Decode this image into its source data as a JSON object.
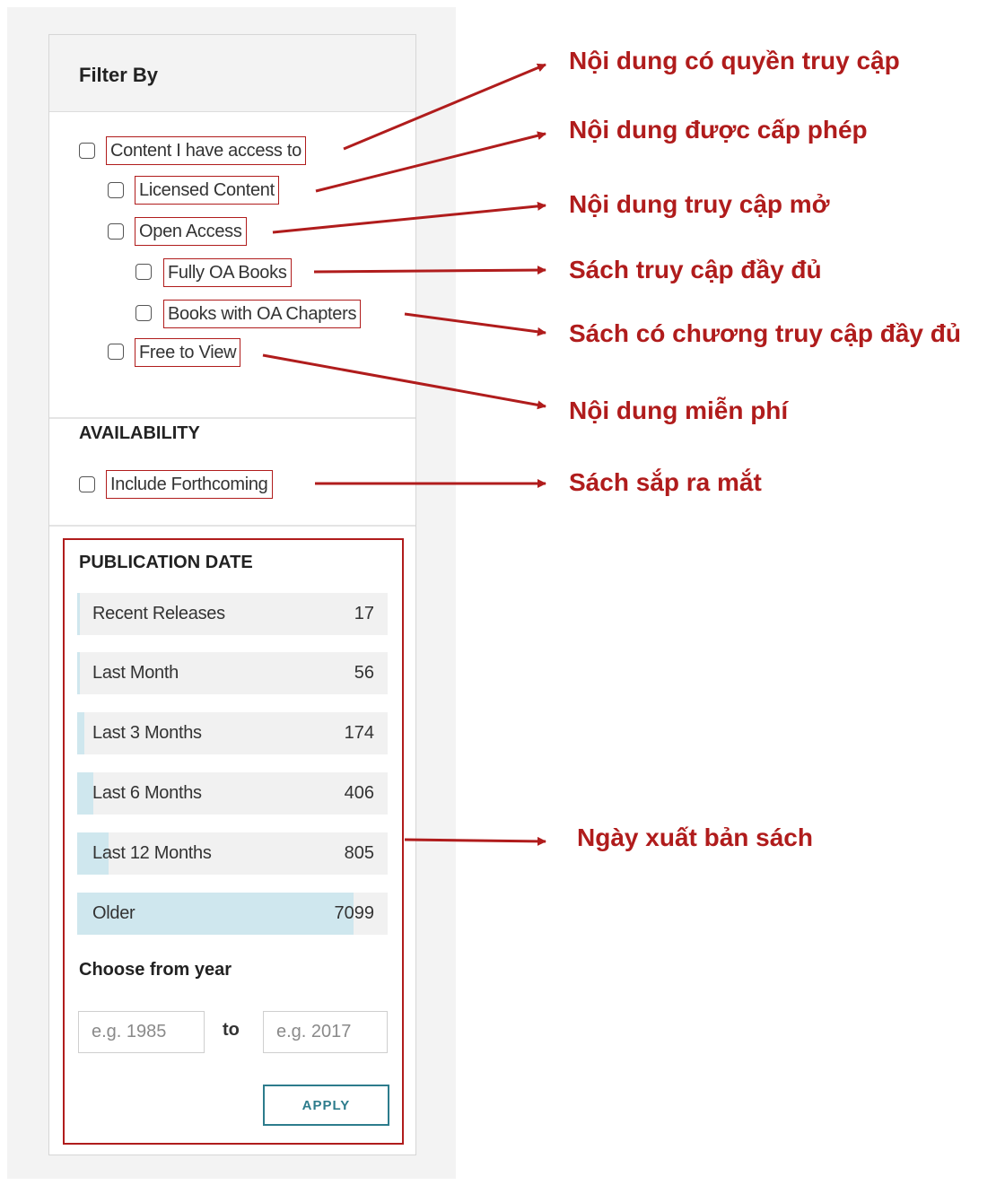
{
  "filter": {
    "title": "Filter By",
    "access_items": [
      {
        "label": "Content I have access to"
      },
      {
        "label": "Licensed Content"
      },
      {
        "label": "Open Access"
      },
      {
        "label": "Fully OA Books"
      },
      {
        "label": "Books with OA Chapters"
      },
      {
        "label": "Free to View"
      }
    ],
    "availability": {
      "title": "AVAILABILITY",
      "items": [
        {
          "label": "Include Forthcoming"
        }
      ]
    },
    "publication_date": {
      "title": "PUBLICATION DATE",
      "max_count": 7099,
      "rows": [
        {
          "label": "Recent Releases",
          "count": "17",
          "value": 17
        },
        {
          "label": "Last Month",
          "count": "56",
          "value": 56
        },
        {
          "label": "Last 3 Months",
          "count": "174",
          "value": 174
        },
        {
          "label": "Last 6 Months",
          "count": "406",
          "value": 406
        },
        {
          "label": "Last 12 Months",
          "count": "805",
          "value": 805
        },
        {
          "label": "Older",
          "count": "7099",
          "value": 7099
        }
      ],
      "year_title": "Choose from year",
      "from_placeholder": "e.g. 1985",
      "to_label": "to",
      "to_placeholder": "e.g. 2017",
      "apply_label": "APPLY"
    }
  },
  "annotations": [
    "Nội dung có quyền truy cập",
    "Nội dung được cấp phép",
    "Nội dung truy cập mở",
    "Sách truy cập đầy đủ",
    "Sách có chương truy cập đầy đủ",
    "Nội dung miễn phí",
    "Sách sắp ra mắt",
    "Ngày xuất bản sách"
  ],
  "colors": {
    "annotation": "#b01c1c",
    "bar_fill": "#cfe7ee",
    "apply_accent": "#2d7c8c"
  }
}
